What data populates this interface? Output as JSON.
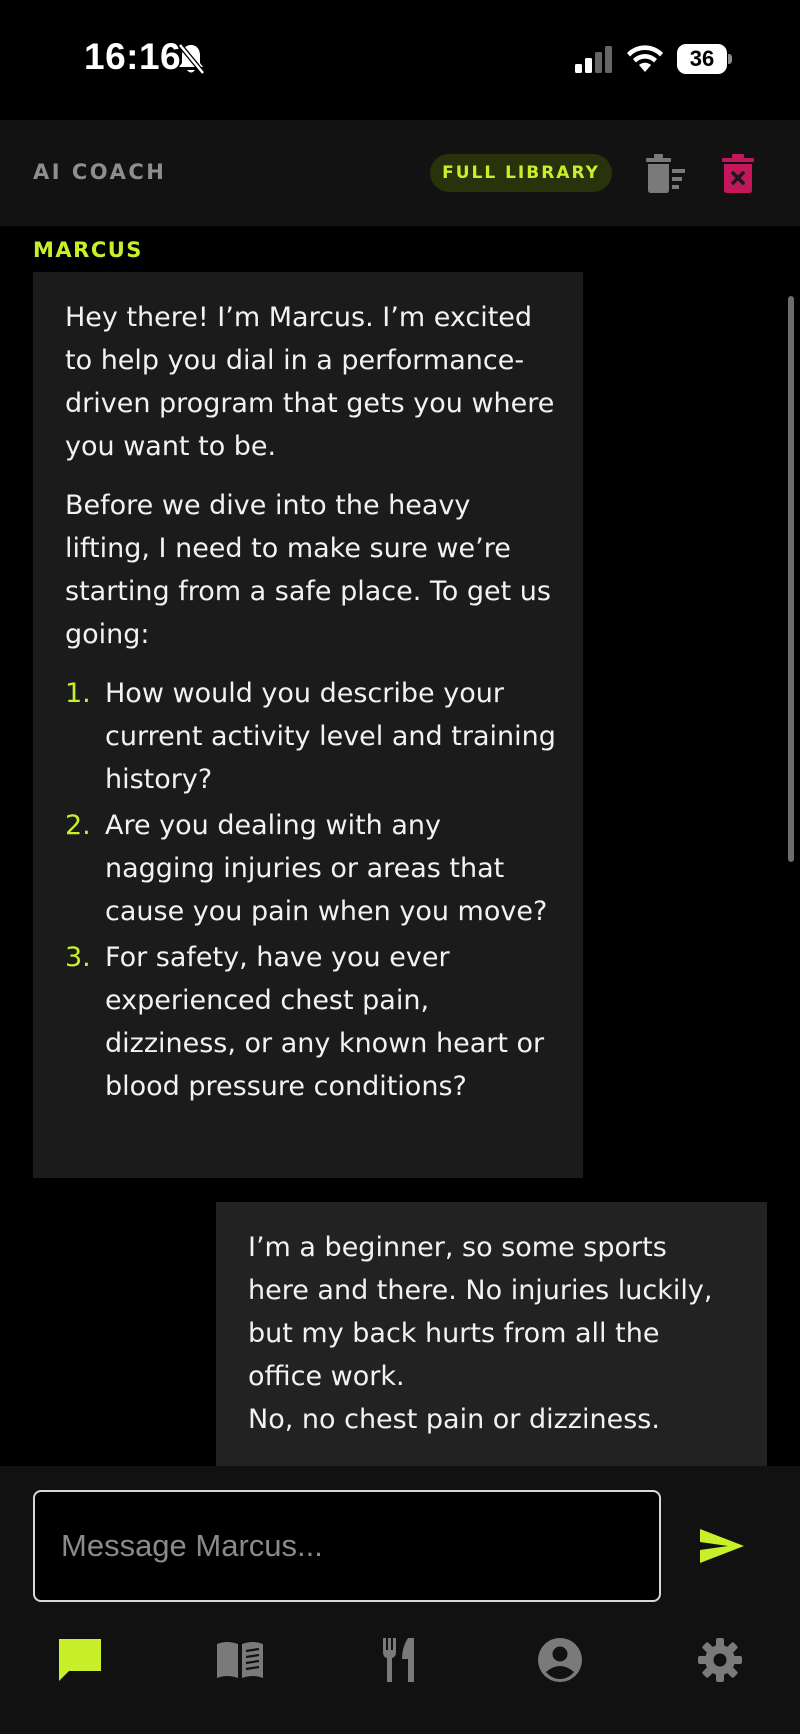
{
  "status_bar": {
    "time": "16:16",
    "battery": "36",
    "icons": [
      "bell-slash-icon",
      "cellular-signal-icon",
      "wifi-icon",
      "battery-icon"
    ]
  },
  "header": {
    "title": "AI COACH",
    "library_label": "FULL LIBRARY",
    "icons": [
      "clear-list-icon",
      "delete-chat-icon"
    ]
  },
  "chat": {
    "coach_message": {
      "sender": "MARCUS",
      "paragraphs": [
        "Hey there! I’m Marcus. I’m excited to help you dial in a performance-driven program that gets you where you want to be.",
        "Before we dive into the heavy lifting, I need to make sure we’re starting from a safe place. To get us going:"
      ],
      "questions": [
        {
          "num": "1.",
          "text": "How would you describe your current activity level and training history?"
        },
        {
          "num": "2.",
          "text": "Are you dealing with any nagging injuries or areas that cause you pain when you move?"
        },
        {
          "num": "3.",
          "text": "For safety, have you ever experienced chest pain, dizziness, or any known heart or blood pressure conditions?"
        }
      ]
    },
    "user_message": {
      "lines": [
        "I’m a beginner, so some sports",
        "here and there. No injuries luckily,",
        "but my back hurts from all the",
        "office work.",
        "No, no chest pain or dizziness."
      ]
    }
  },
  "composer": {
    "placeholder": "Message Marcus...",
    "value": "",
    "send_icon": "send-icon"
  },
  "nav": {
    "active": "chat",
    "tabs": [
      "chat-icon",
      "book-icon",
      "fork-knife-icon",
      "profile-icon",
      "settings-icon"
    ]
  },
  "colors": {
    "accent": "#C8F02A",
    "danger": "#C2185B",
    "background": "#000000",
    "coach_bubble": "#1B1B1B",
    "user_bubble": "#222222",
    "header": "#121212"
  }
}
